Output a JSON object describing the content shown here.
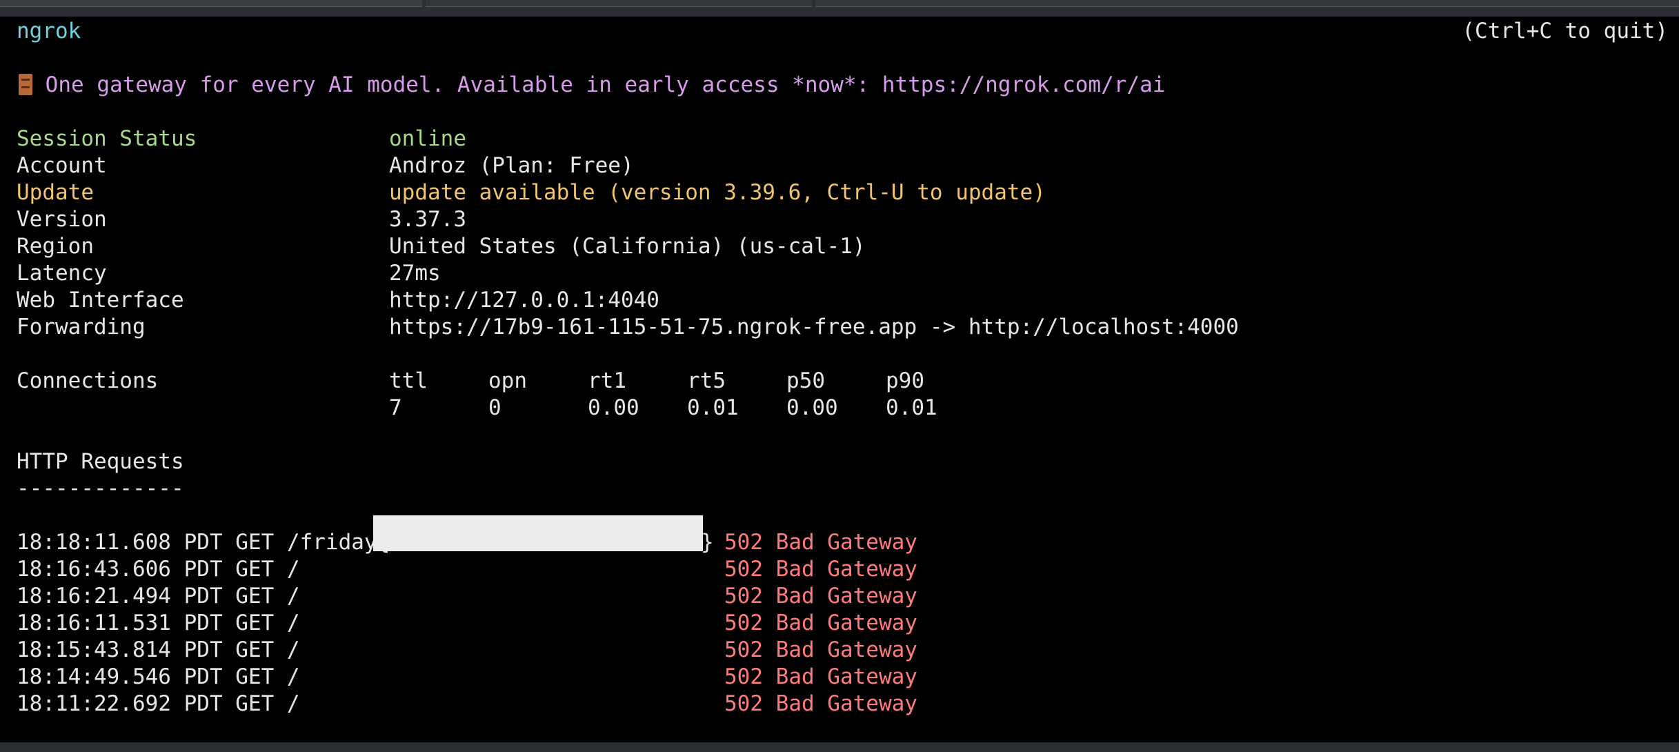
{
  "header": {
    "app": "ngrok",
    "quit_hint": "(Ctrl+C to quit)"
  },
  "banner": {
    "icon": "door-icon",
    "text": "One gateway for every AI model. Available in early access *now*: https://ngrok.com/r/ai"
  },
  "status": {
    "session_label": "Session Status",
    "session_value": "online",
    "account_label": "Account",
    "account_value": "Androz (Plan: Free)",
    "update_label": "Update",
    "update_value": "update available (version 3.39.6, Ctrl-U to update)",
    "version_label": "Version",
    "version_value": "3.37.3",
    "region_label": "Region",
    "region_value": "United States (California) (us-cal-1)",
    "latency_label": "Latency",
    "latency_value": "27ms",
    "web_label": "Web Interface",
    "web_value": "http://127.0.0.1:4040",
    "forwarding_label": "Forwarding",
    "forwarding_value": "https://17b9-161-115-51-75.ngrok-free.app -> http://localhost:4000"
  },
  "connections": {
    "label": "Connections",
    "headers": [
      "ttl",
      "opn",
      "rt1",
      "rt5",
      "p50",
      "p90"
    ],
    "values": [
      "7",
      "0",
      "0.00",
      "0.01",
      "0.00",
      "0.01"
    ]
  },
  "http": {
    "title": "HTTP Requests",
    "divider": "-------------",
    "requests": [
      {
        "request": "18:18:11.608 PDT GET /friday{",
        "close": "}",
        "status": "502 Bad Gateway"
      },
      {
        "request": "18:16:43.606 PDT GET /",
        "status": "502 Bad Gateway"
      },
      {
        "request": "18:16:21.494 PDT GET /",
        "status": "502 Bad Gateway"
      },
      {
        "request": "18:16:11.531 PDT GET /",
        "status": "502 Bad Gateway"
      },
      {
        "request": "18:15:43.814 PDT GET /",
        "status": "502 Bad Gateway"
      },
      {
        "request": "18:14:49.546 PDT GET /",
        "status": "502 Bad Gateway"
      },
      {
        "request": "18:11:22.692 PDT GET /",
        "status": "502 Bad Gateway"
      }
    ]
  },
  "colors": {
    "background": "#000000",
    "text": "#e6e6e6",
    "title_cyan": "#6fd3de",
    "online_green": "#a6d98c",
    "update_yellow": "#f2c46d",
    "banner_magenta": "#d79bea",
    "error_red": "#ff7b7b"
  }
}
